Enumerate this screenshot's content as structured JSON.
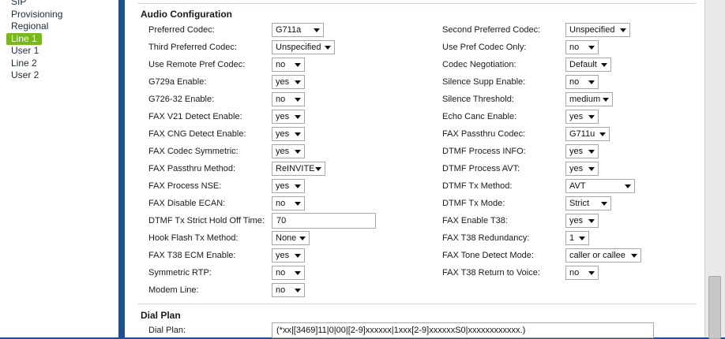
{
  "nav": {
    "items": [
      "SIP",
      "Provisioning",
      "Regional",
      "Line 1",
      "User 1",
      "Line 2",
      "User 2"
    ],
    "active": "Line 1"
  },
  "audio": {
    "title": "Audio Configuration",
    "left": [
      {
        "label": "Preferred Codec:",
        "value": "G711a"
      },
      {
        "label": "Third Preferred Codec:",
        "value": "Unspecified"
      },
      {
        "label": "Use Remote Pref Codec:",
        "value": "no"
      },
      {
        "label": "G729a Enable:",
        "value": "yes"
      },
      {
        "label": "G726-32 Enable:",
        "value": "no"
      },
      {
        "label": "FAX V21 Detect Enable:",
        "value": "yes"
      },
      {
        "label": "FAX CNG Detect Enable:",
        "value": "yes"
      },
      {
        "label": "FAX Codec Symmetric:",
        "value": "yes"
      },
      {
        "label": "FAX Passthru Method:",
        "value": "ReINVITE"
      },
      {
        "label": "FAX Process NSE:",
        "value": "yes"
      },
      {
        "label": "FAX Disable ECAN:",
        "value": "no"
      },
      {
        "label": "DTMF Tx Strict Hold Off Time:",
        "value": "70"
      },
      {
        "label": "Hook Flash Tx Method:",
        "value": "None"
      },
      {
        "label": "FAX T38 ECM Enable:",
        "value": "yes"
      },
      {
        "label": "Symmetric RTP:",
        "value": "no"
      },
      {
        "label": "Modem Line:",
        "value": "no"
      }
    ],
    "right": [
      {
        "label": "Second Preferred Codec:",
        "value": "Unspecified"
      },
      {
        "label": "Use Pref Codec Only:",
        "value": "no"
      },
      {
        "label": "Codec Negotiation:",
        "value": "Default"
      },
      {
        "label": "Silence Supp Enable:",
        "value": "no"
      },
      {
        "label": "Silence Threshold:",
        "value": "medium"
      },
      {
        "label": "Echo Canc Enable:",
        "value": "yes"
      },
      {
        "label": "FAX Passthru Codec:",
        "value": "G711u"
      },
      {
        "label": "DTMF Process INFO:",
        "value": "yes"
      },
      {
        "label": "DTMF Process AVT:",
        "value": "yes"
      },
      {
        "label": "DTMF Tx Method:",
        "value": "AVT"
      },
      {
        "label": "DTMF Tx Mode:",
        "value": "Strict"
      },
      {
        "label": "FAX Enable T38:",
        "value": "yes"
      },
      {
        "label": "FAX T38 Redundancy:",
        "value": "1"
      },
      {
        "label": "FAX Tone Detect Mode:",
        "value": "caller or callee"
      },
      {
        "label": "FAX T38 Return to Voice:",
        "value": "no"
      }
    ]
  },
  "dialplan": {
    "title": "Dial Plan",
    "label": "Dial Plan:",
    "value": "(*xx|[3469]11|0|00|[2-9]xxxxxx|1xxx[2-9]xxxxxxS0|xxxxxxxxxxxx.)"
  }
}
